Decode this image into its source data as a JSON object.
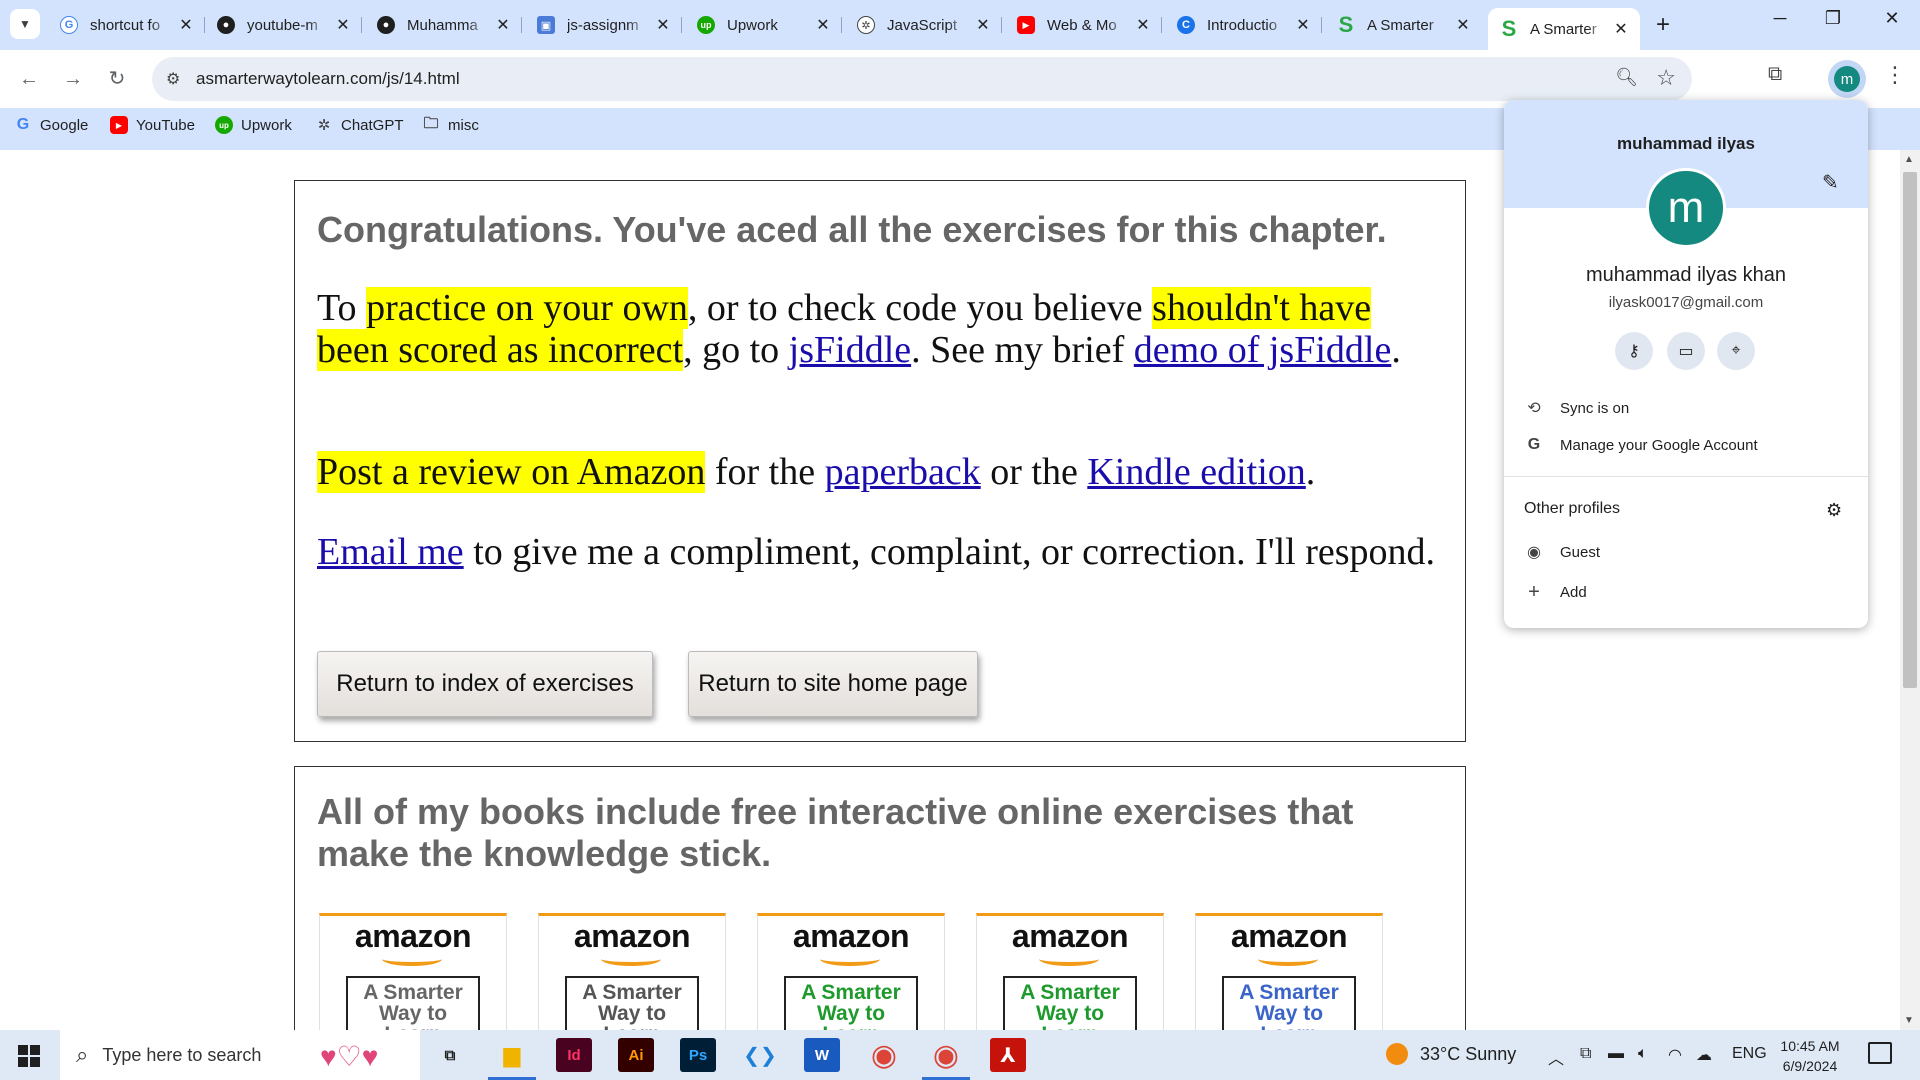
{
  "tabs": [
    {
      "title": "shortcut fo",
      "icon": "google-icon",
      "color": "#4285f4",
      "glyph": "G"
    },
    {
      "title": "youtube-m",
      "icon": "github-icon",
      "color": "#1f1f1f",
      "glyph": "●"
    },
    {
      "title": "Muhamma",
      "icon": "github-icon",
      "color": "#1f1f1f",
      "glyph": "●"
    },
    {
      "title": "js-assignm",
      "icon": "classroom-icon",
      "color": "#4a7bd6",
      "glyph": "▣"
    },
    {
      "title": "Upwork",
      "icon": "upwork-icon",
      "color": "#14a800",
      "glyph": "up"
    },
    {
      "title": "JavaScript",
      "icon": "chatgpt-icon",
      "color": "#444444",
      "glyph": "✲"
    },
    {
      "title": "Web & Mo",
      "icon": "youtube-icon",
      "color": "#ff0000",
      "glyph": "▶"
    },
    {
      "title": "Introductio",
      "icon": "course-icon",
      "color": "#1a73e8",
      "glyph": "C"
    },
    {
      "title": "A Smarter",
      "icon": "smarter-way-icon",
      "color": "#2aa845",
      "glyph": "S"
    },
    {
      "title": "A Smarter",
      "icon": "smarter-way-icon",
      "color": "#2aa845",
      "glyph": "S"
    }
  ],
  "address": {
    "url": "asmarterwaytolearn.com/js/14.html"
  },
  "bookmarks": [
    {
      "label": "Google",
      "icon": "google-icon"
    },
    {
      "label": "YouTube",
      "icon": "youtube-icon"
    },
    {
      "label": "Upwork",
      "icon": "upwork-icon"
    },
    {
      "label": "ChatGPT",
      "icon": "chatgpt-icon"
    },
    {
      "label": "misc",
      "icon": "folder-icon"
    }
  ],
  "content": {
    "congrats": "Congratulations. You've aced all the exercises for this chapter.",
    "p1": {
      "t1": "To ",
      "h1": "practice on your own",
      "t2": ", or to check code you believe ",
      "h2": "shouldn't have been scored as incorrect",
      "t3": ", go to ",
      "l1": "jsFiddle",
      "t4": ". See my brief ",
      "l2": "demo of jsFiddle",
      "t5": "."
    },
    "p2": {
      "h1": "Post a review on Amazon",
      "t1": " for the ",
      "l1": "paperback",
      "t2": " or the ",
      "l2": "Kindle edition",
      "t3": "."
    },
    "p3": {
      "l1": "Email me",
      "t1": " to give me a compliment, complaint, or correction. I'll respond."
    },
    "btn_index": "Return to index of exercises",
    "btn_home": "Return to site home page",
    "books_heading": " All of my books include free interactive online exercises that make the knowledge stick.",
    "books": [
      {
        "brand": "amazon",
        "cover": "A Smarter Way to Learn",
        "color": "#666666"
      },
      {
        "brand": "amazon",
        "cover": "A Smarter Way to Learn",
        "color": "#555555"
      },
      {
        "brand": "amazon",
        "cover": "A Smarter Way to Learn",
        "color": "#1e9a2c"
      },
      {
        "brand": "amazon",
        "cover": "A Smarter Way to Learn",
        "color": "#1e9a2c"
      },
      {
        "brand": "amazon",
        "cover": "A Smarter Way to Learn",
        "color": "#3a64c8"
      }
    ]
  },
  "profile": {
    "avatar_letter": "m",
    "menu_title": "muhammad ilyas",
    "full_name": "muhammad ilyas khan",
    "email": "ilyask0017@gmail.com",
    "sync": "Sync is on",
    "manage": "Manage your Google Account",
    "other_profiles": "Other profiles",
    "guest": "Guest",
    "add": "Add"
  },
  "taskbar": {
    "search_placeholder": "Type here to search",
    "weather": "33°C  Sunny",
    "lang": "ENG",
    "time": "10:45 AM",
    "date": "6/9/2024",
    "apps": [
      {
        "name": "task-view",
        "glyph": "⧉"
      },
      {
        "name": "file-explorer",
        "glyph": "▆"
      },
      {
        "name": "indesign",
        "glyph": "Id"
      },
      {
        "name": "illustrator",
        "glyph": "Ai"
      },
      {
        "name": "photoshop",
        "glyph": "Ps"
      },
      {
        "name": "vscode",
        "glyph": "❮❯"
      },
      {
        "name": "word",
        "glyph": "W"
      },
      {
        "name": "chrome",
        "glyph": "◉"
      },
      {
        "name": "chrome-profile",
        "glyph": "◉"
      },
      {
        "name": "acrobat",
        "glyph": "⅄"
      }
    ]
  }
}
